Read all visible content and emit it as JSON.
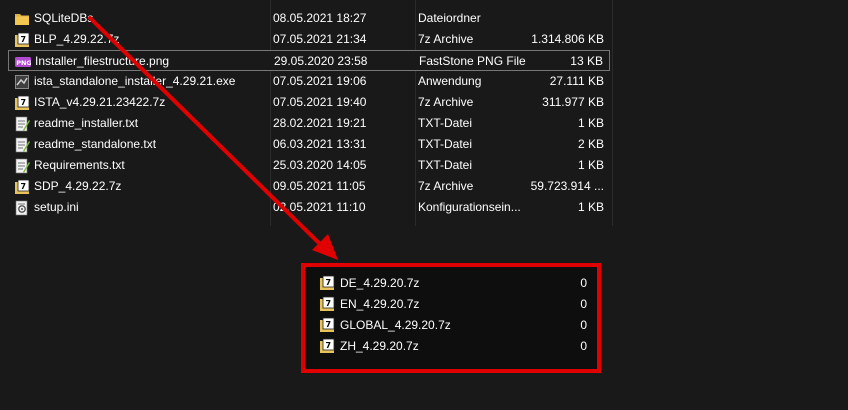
{
  "files": [
    {
      "name": "SQLiteDBs",
      "date": "08.05.2021 18:27",
      "type": "Dateiordner",
      "size": "",
      "icon": "folder-icon"
    },
    {
      "name": "BLP_4.29.22.7z",
      "date": "07.05.2021 21:34",
      "type": "7z Archive",
      "size": "1.314.806 KB",
      "icon": "7z-archive-icon"
    },
    {
      "name": "Installer_filestructure.png",
      "date": "29.05.2020 23:58",
      "type": "FastStone PNG File",
      "size": "13 KB",
      "icon": "png-file-icon"
    },
    {
      "name": "ista_standalone_installer_4.29.21.exe",
      "date": "07.05.2021 19:06",
      "type": "Anwendung",
      "size": "27.111 KB",
      "icon": "exe-installer-icon"
    },
    {
      "name": "ISTA_v4.29.21.23422.7z",
      "date": "07.05.2021 19:40",
      "type": "7z Archive",
      "size": "311.977 KB",
      "icon": "7z-archive-icon"
    },
    {
      "name": "readme_installer.txt",
      "date": "28.02.2021 19:21",
      "type": "TXT-Datei",
      "size": "1 KB",
      "icon": "txt-file-icon"
    },
    {
      "name": "readme_standalone.txt",
      "date": "06.03.2021 13:31",
      "type": "TXT-Datei",
      "size": "2 KB",
      "icon": "txt-file-icon"
    },
    {
      "name": "Requirements.txt",
      "date": "25.03.2020 14:05",
      "type": "TXT-Datei",
      "size": "1 KB",
      "icon": "txt-file-icon"
    },
    {
      "name": "SDP_4.29.22.7z",
      "date": "09.05.2021 11:05",
      "type": "7z Archive",
      "size": "59.723.914 ...",
      "icon": "7z-archive-icon"
    },
    {
      "name": "setup.ini",
      "date": "02.05.2021 11:10",
      "type": "Konfigurationsein...",
      "size": "1 KB",
      "icon": "ini-settings-icon"
    }
  ],
  "sqlite_contents": [
    {
      "name": "DE_4.29.20.7z",
      "size": "0",
      "icon": "7z-archive-icon"
    },
    {
      "name": "EN_4.29.20.7z",
      "size": "0",
      "icon": "7z-archive-icon"
    },
    {
      "name": "GLOBAL_4.29.20.7z",
      "size": "0",
      "icon": "7z-archive-icon"
    },
    {
      "name": "ZH_4.29.20.7z",
      "size": "0",
      "icon": "7z-archive-icon"
    }
  ],
  "colors": {
    "background": "#191919",
    "highlight_red": "#e00000",
    "folder_yellow": "#f3c74f"
  }
}
